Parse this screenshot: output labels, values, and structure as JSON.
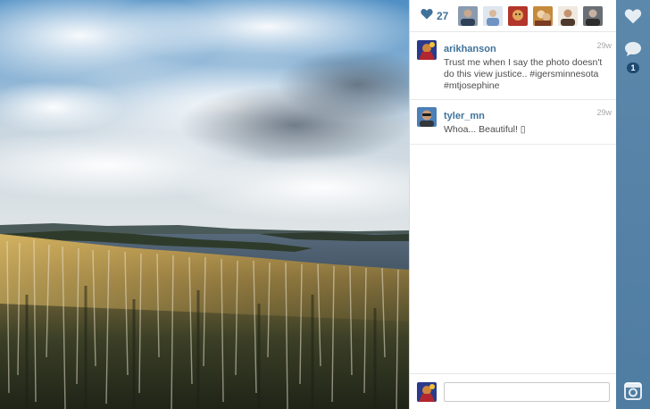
{
  "likes": {
    "count": "27",
    "likers": [
      {
        "name": "liker-1"
      },
      {
        "name": "liker-2"
      },
      {
        "name": "liker-3"
      },
      {
        "name": "liker-4"
      },
      {
        "name": "liker-5"
      },
      {
        "name": "liker-6"
      }
    ]
  },
  "comments": [
    {
      "username": "arikhanson",
      "time": "29w",
      "text": "Trust me when I say the photo doesn't do this view justice.. #igersminnesota #mtjosephine"
    },
    {
      "username": "tyler_mn",
      "time": "29w",
      "text": "Whoa... Beautiful! ▯"
    }
  ],
  "composer": {
    "value": "",
    "placeholder": ""
  },
  "rail": {
    "comment_count": "1",
    "icons": [
      "heart-icon",
      "comment-icon",
      "camera-icon"
    ]
  },
  "colors": {
    "link_blue": "#3f729b",
    "rail_blue": "#517fa4",
    "badge_blue": "#1d4a70"
  }
}
